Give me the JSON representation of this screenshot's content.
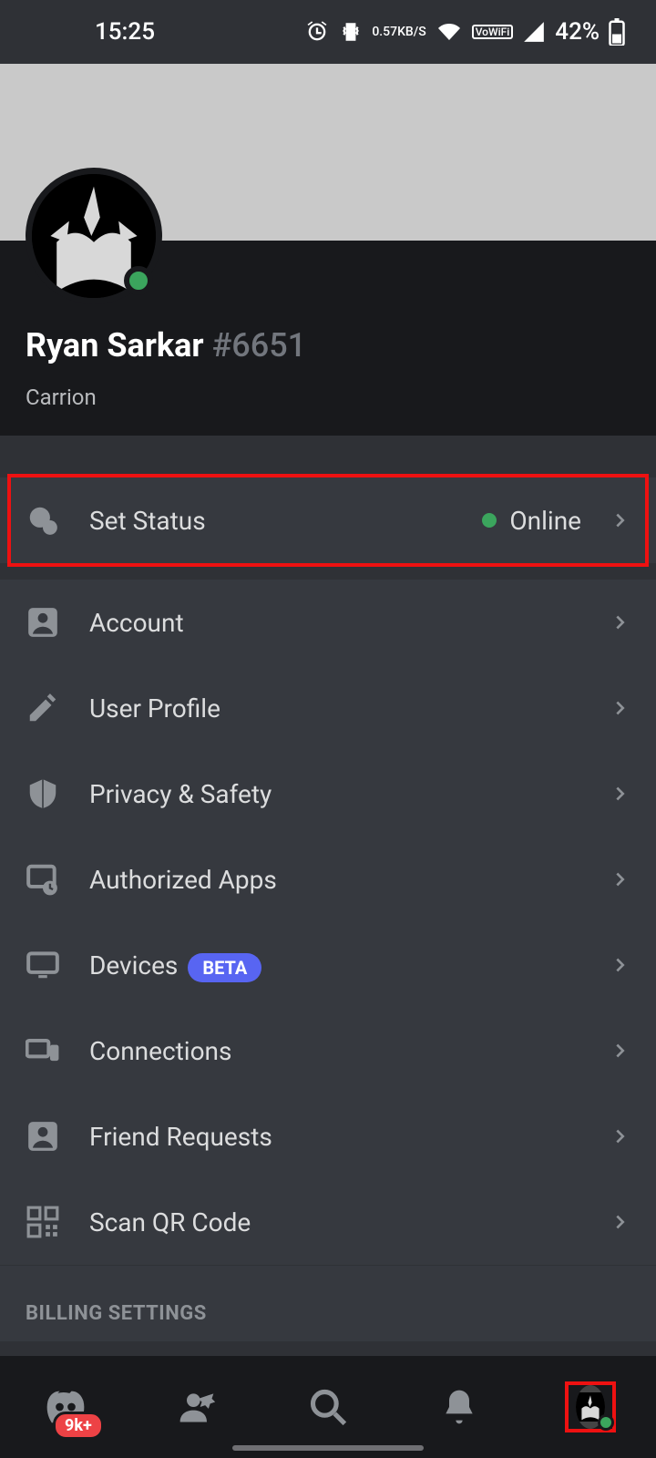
{
  "status_bar": {
    "time": "15:25",
    "kbs_value": "0.57",
    "kbs_unit": "KB/S",
    "vowifi": "VoWiFi",
    "battery": "42%"
  },
  "profile": {
    "display_name": "Ryan Sarkar",
    "discriminator": "#6651",
    "activity": "Carrion",
    "status_color": "#3ba55d"
  },
  "settings": {
    "set_status": {
      "label": "Set Status",
      "value": "Online"
    },
    "account": {
      "label": "Account"
    },
    "user_profile": {
      "label": "User Profile"
    },
    "privacy": {
      "label": "Privacy & Safety"
    },
    "authorized_apps": {
      "label": "Authorized Apps"
    },
    "devices": {
      "label": "Devices",
      "badge": "BETA"
    },
    "connections": {
      "label": "Connections"
    },
    "friend_requests": {
      "label": "Friend Requests"
    },
    "scan_qr": {
      "label": "Scan QR Code"
    }
  },
  "section_headers": {
    "billing": "BILLING SETTINGS"
  },
  "bottom_nav": {
    "notification_badge": "9k+"
  }
}
